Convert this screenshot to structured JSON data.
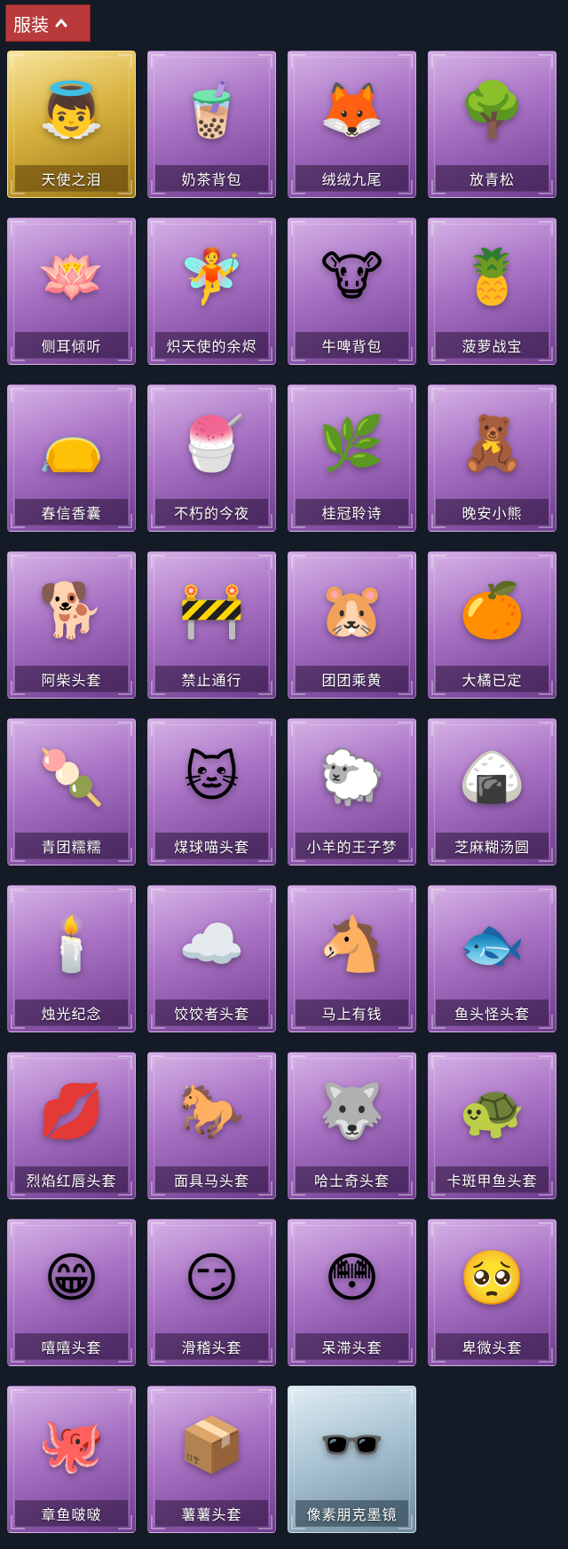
{
  "section": {
    "title": "服装",
    "toggle_icon": "chevron-up-icon"
  },
  "items": [
    {
      "name": "天使之泪",
      "icon": "angel-icon",
      "glyph": "👼",
      "variant": "gold"
    },
    {
      "name": "奶茶背包",
      "icon": "milk-tea-backpack-icon",
      "glyph": "🧋",
      "variant": "purple"
    },
    {
      "name": "绒绒九尾",
      "icon": "nine-tail-fox-icon",
      "glyph": "🦊",
      "variant": "purple"
    },
    {
      "name": "放青松",
      "icon": "bonsai-pine-icon",
      "glyph": "🌳",
      "variant": "purple"
    },
    {
      "name": "侧耳倾听",
      "icon": "flower-wreath-icon",
      "glyph": "🪷",
      "variant": "purple"
    },
    {
      "name": "炽天使的余烬",
      "icon": "angel-doll-icon",
      "glyph": "🧚",
      "variant": "purple"
    },
    {
      "name": "牛啤背包",
      "icon": "cow-barrel-icon",
      "glyph": "🐮",
      "variant": "purple"
    },
    {
      "name": "菠萝战宝",
      "icon": "pineapple-robot-icon",
      "glyph": "🍍",
      "variant": "purple"
    },
    {
      "name": "春信香囊",
      "icon": "sachet-icon",
      "glyph": "👝",
      "variant": "purple"
    },
    {
      "name": "不朽的今夜",
      "icon": "fox-bowl-charm-icon",
      "glyph": "🍧",
      "variant": "purple"
    },
    {
      "name": "桂冠聆诗",
      "icon": "laurel-charm-icon",
      "glyph": "🌿",
      "variant": "purple"
    },
    {
      "name": "晚安小熊",
      "icon": "teddy-bear-icon",
      "glyph": "🧸",
      "variant": "purple"
    },
    {
      "name": "阿柴头套",
      "icon": "shiba-head-icon",
      "glyph": "🐕",
      "variant": "purple"
    },
    {
      "name": "禁止通行",
      "icon": "traffic-cone-icon",
      "glyph": "🚧",
      "variant": "purple"
    },
    {
      "name": "团团乘黄",
      "icon": "round-beast-icon",
      "glyph": "🐹",
      "variant": "purple"
    },
    {
      "name": "大橘已定",
      "icon": "orange-slice-icon",
      "glyph": "🍊",
      "variant": "purple"
    },
    {
      "name": "青团糯糯",
      "icon": "green-dumpling-icon",
      "glyph": "🍡",
      "variant": "purple"
    },
    {
      "name": "煤球喵头套",
      "icon": "black-cat-head-icon",
      "glyph": "🐱",
      "variant": "purple"
    },
    {
      "name": "小羊的王子梦",
      "icon": "crowned-sheep-icon",
      "glyph": "🐑",
      "variant": "purple"
    },
    {
      "name": "芝麻糊汤圆",
      "icon": "rice-ball-icon",
      "glyph": "🍙",
      "variant": "purple"
    },
    {
      "name": "烛光纪念",
      "icon": "candle-icon",
      "glyph": "🕯️",
      "variant": "purple"
    },
    {
      "name": "饺饺者头套",
      "icon": "cloud-dumpling-icon",
      "glyph": "☁️",
      "variant": "purple"
    },
    {
      "name": "马上有钱",
      "icon": "red-horse-icon",
      "glyph": "🐴",
      "variant": "purple"
    },
    {
      "name": "鱼头怪头套",
      "icon": "fish-head-icon",
      "glyph": "🐟",
      "variant": "purple"
    },
    {
      "name": "烈焰红唇头套",
      "icon": "red-lips-head-icon",
      "glyph": "💋",
      "variant": "purple"
    },
    {
      "name": "面具马头套",
      "icon": "horse-mask-icon",
      "glyph": "🐎",
      "variant": "purple"
    },
    {
      "name": "哈士奇头套",
      "icon": "husky-sunglasses-icon",
      "glyph": "🐺",
      "variant": "purple"
    },
    {
      "name": "卡斑甲鱼头套",
      "icon": "turtle-head-icon",
      "glyph": "🐢",
      "variant": "purple"
    },
    {
      "name": "嘻嘻头套",
      "icon": "grin-emoji-icon",
      "glyph": "😁",
      "variant": "purple"
    },
    {
      "name": "滑稽头套",
      "icon": "smirk-emoji-icon",
      "glyph": "😏",
      "variant": "purple"
    },
    {
      "name": "呆滞头套",
      "icon": "stare-emoji-icon",
      "glyph": "😳",
      "variant": "purple"
    },
    {
      "name": "卑微头套",
      "icon": "humble-emoji-icon",
      "glyph": "🥺",
      "variant": "purple"
    },
    {
      "name": "章鱼啵啵",
      "icon": "octopus-icon",
      "glyph": "🐙",
      "variant": "purple"
    },
    {
      "name": "薯薯头套",
      "icon": "box-head-icon",
      "glyph": "📦",
      "variant": "purple"
    },
    {
      "name": "像素朋克墨镜",
      "icon": "pixel-sunglasses-icon",
      "glyph": "🕶️",
      "variant": "blue"
    }
  ]
}
